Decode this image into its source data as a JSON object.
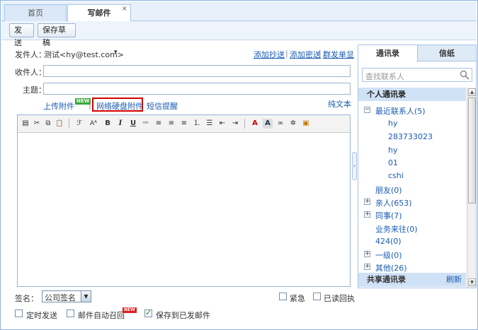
{
  "tabs": [
    {
      "label": "首页"
    },
    {
      "label": "写邮件",
      "close": "×"
    }
  ],
  "toolbar": {
    "send_label": "发送",
    "draft_label": "保存草稿"
  },
  "compose": {
    "from_label": "发件人：",
    "from_value": "测试<hy@test.com>",
    "from_caret": "▾",
    "add_cc": "添加抄送",
    "add_bcc": "添加密送",
    "separate_send": "群发单显",
    "divider": "|",
    "to_label": "收件人：",
    "subject_label": "主题：",
    "upload_attachment": "上传附件",
    "upload_new_tag": "NEW",
    "netdisk_attachment": "网络硬盘附件",
    "sms_reminder": "短信提醒",
    "plain_text": "纯文本"
  },
  "editor": {
    "tools": [
      {
        "name": "source-icon",
        "glyph": "▤"
      },
      {
        "name": "cut-icon",
        "glyph": "✂"
      },
      {
        "name": "copy-icon",
        "glyph": "⧉"
      },
      {
        "name": "paste-icon",
        "glyph": "📋"
      },
      {
        "name": "font-family-icon",
        "glyph": "ℱ"
      },
      {
        "name": "font-size-icon",
        "glyph": "Aᴬ"
      },
      {
        "name": "bold-icon",
        "glyph": "B"
      },
      {
        "name": "italic-icon",
        "glyph": "I"
      },
      {
        "name": "underline-icon",
        "glyph": "U"
      },
      {
        "name": "strikethrough-icon",
        "glyph": "ᴬᴮᶜ"
      },
      {
        "name": "align-left-icon",
        "glyph": "≡"
      },
      {
        "name": "align-center-icon",
        "glyph": "≡"
      },
      {
        "name": "align-right-icon",
        "glyph": "≡"
      },
      {
        "name": "ordered-list-icon",
        "glyph": "⒈"
      },
      {
        "name": "unordered-list-icon",
        "glyph": "☰"
      },
      {
        "name": "outdent-icon",
        "glyph": "⇤"
      },
      {
        "name": "indent-icon",
        "glyph": "⇥"
      },
      {
        "name": "font-color-icon",
        "glyph": "A"
      },
      {
        "name": "highlight-color-icon",
        "glyph": "A"
      },
      {
        "name": "link-icon",
        "glyph": "∞"
      },
      {
        "name": "unlink-icon",
        "glyph": "✲"
      },
      {
        "name": "image-icon",
        "glyph": "▣"
      }
    ]
  },
  "bottom": {
    "signature_label": "签名：",
    "signature_value": "公司签名",
    "urgent_label": "紧急",
    "read_receipt_label": "已读回执",
    "scheduled_send_label": "定时发送",
    "auto_recall_label": "邮件自动召回",
    "auto_recall_new": "NEW",
    "save_sent_label": "保存到已发邮件"
  },
  "contacts": {
    "tab_contacts": "通讯录",
    "tab_stationery": "信纸",
    "search_placeholder": "查找联系人",
    "personal_header": "个人通讯录",
    "recent_group": "最近联系人(5)",
    "recent_members": [
      "hy",
      "283733023",
      "hy",
      "01",
      "cshi"
    ],
    "friends": "朋友(0)",
    "family": "亲人(653)",
    "colleagues": "同事(7)",
    "business": "业务来往(0)",
    "g424": "424(0)",
    "level1": "一级(0)",
    "other": "其他(26)",
    "shared_header": "共享通讯录",
    "refresh": "刷新"
  },
  "colors": {
    "accent": "#1a5bb5",
    "border": "#a9c4e8",
    "highlight": "#d40000"
  }
}
